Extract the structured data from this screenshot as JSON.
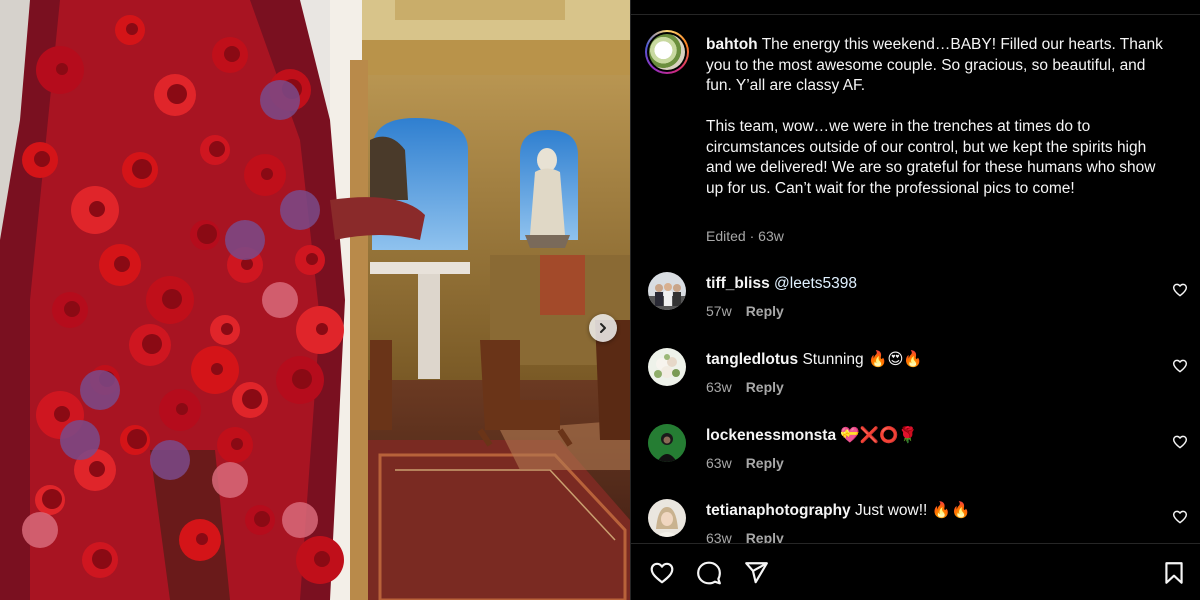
{
  "post": {
    "username": "bahtoh",
    "caption_p1": "The energy this weekend…BABY! Filled our hearts. Thank you to the most awesome couple. So gracious, so beautiful, and fun. Y’all are classy AF.",
    "caption_p2": "This team, wow…we were in the trenches at times do to circumstances outside of our control, but we kept the spirits high and we delivered! We are so grateful for these humans who show up for us. Can’t wait for the professional pics to come!",
    "edited_label": "Edited",
    "separator": "·",
    "time": "63w"
  },
  "comments": [
    {
      "username": "tiff_bliss",
      "text": "@leets5398",
      "time": "57w",
      "reply": "Reply",
      "avatar_icon": "group-photo-avatar"
    },
    {
      "username": "tangledlotus",
      "text": "Stunning 🔥😍🔥",
      "time": "63w",
      "reply": "Reply",
      "avatar_icon": "flowers-avatar"
    },
    {
      "username": "lockenessmonsta",
      "text": "💝❌⭕🌹",
      "time": "63w",
      "reply": "Reply",
      "avatar_icon": "green-portrait-avatar"
    },
    {
      "username": "tetianaphotography",
      "text": "Just wow!! 🔥🔥",
      "time": "63w",
      "reply": "Reply",
      "avatar_icon": "portrait-avatar"
    }
  ],
  "icons": {
    "like": "heart-icon",
    "comment": "comment-icon",
    "share": "send-icon",
    "save": "bookmark-icon",
    "next": "chevron-right-icon"
  },
  "colors": {
    "background": "#000000",
    "text": "#f5f5f5",
    "secondary_text": "#a8a8a8",
    "divider": "#262626"
  }
}
